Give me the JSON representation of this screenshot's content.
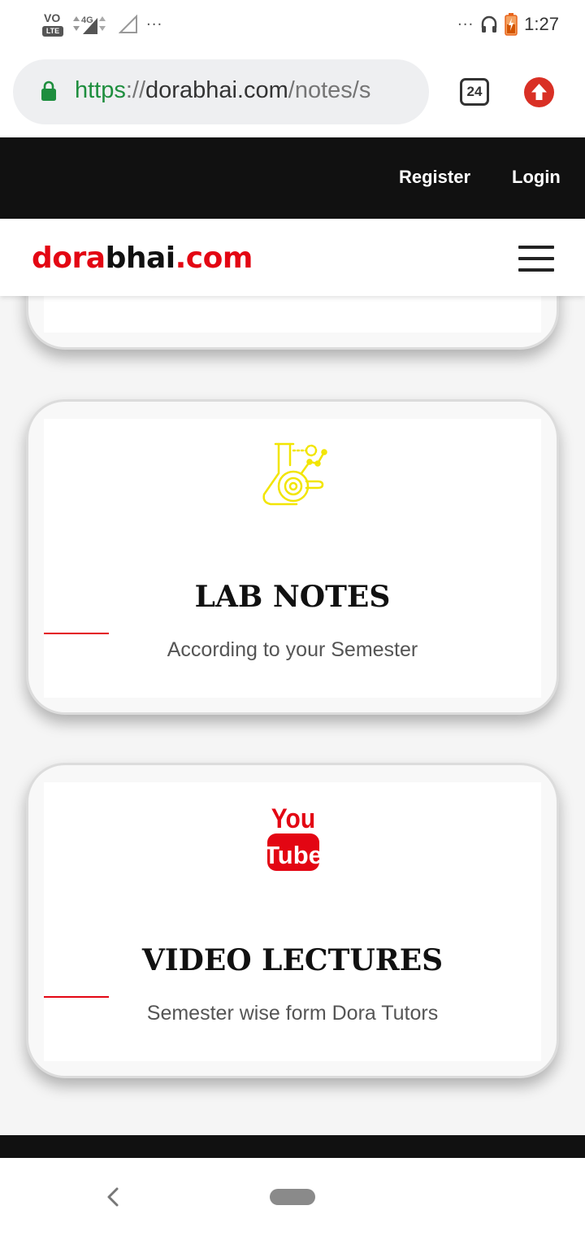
{
  "status_bar": {
    "volte_top": "VO",
    "volte_bottom": "LTE",
    "network": "4G",
    "dots_left": "···",
    "dots_right": "···",
    "time": "1:27"
  },
  "browser": {
    "url_scheme": "https",
    "url_sep": "://",
    "url_host": "dorabhai.com",
    "url_path": "/notes/s",
    "tab_count": "24"
  },
  "topnav": {
    "register": "Register",
    "login": "Login"
  },
  "brand": {
    "part1": "dora",
    "part2": "bhai",
    "part3": ".com"
  },
  "cards": [
    {
      "title": "LAB NOTES",
      "subtitle": "According to your Semester",
      "icon": "lab-flask-icon"
    },
    {
      "title": "VIDEO LECTURES",
      "subtitle": "Semester wise form Dora Tutors",
      "icon": "youtube-icon",
      "logo_top": "You",
      "logo_bottom": "Tube"
    }
  ],
  "colors": {
    "brand_red": "#e30613",
    "nav_black": "#111111",
    "url_green": "#1e8e3e",
    "lab_icon_yellow": "#f2e500"
  }
}
